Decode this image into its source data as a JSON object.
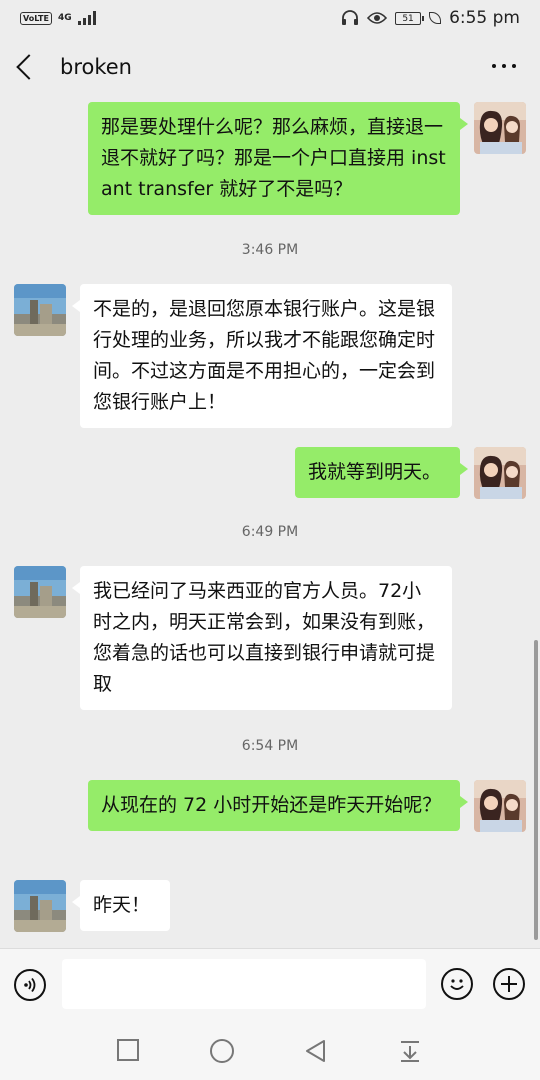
{
  "status": {
    "time": "6:55 pm",
    "battery": "51",
    "volte": "VoLTE",
    "network": "4G"
  },
  "header": {
    "title": "broken"
  },
  "messages": [
    {
      "side": "out",
      "text": "那是要处理什么呢？那么麻烦，直接退一退不就好了吗？那是一个户口直接用 instant transfer 就好了不是吗？"
    },
    {
      "time": "3:46 PM"
    },
    {
      "side": "in",
      "text": "不是的，是退回您原本银行账户。这是银行处理的业务，所以我才不能跟您确定时间。不过这方面是不用担心的，一定会到您银行账户上！"
    },
    {
      "side": "out",
      "text": "我就等到明天。"
    },
    {
      "time": "6:49 PM"
    },
    {
      "side": "in",
      "text": "我已经问了马来西亚的官方人员。72小时之内，明天正常会到，如果没有到账，您着急的话也可以直接到银行申请就可提取"
    },
    {
      "time": "6:54 PM"
    },
    {
      "side": "out",
      "text": "从现在的 72 小时开始还是昨天开始呢？"
    },
    {
      "side": "in",
      "text": "昨天！"
    }
  ],
  "input": {
    "value": ""
  },
  "icons": {
    "voice": "voice-icon",
    "emoji": "emoji-icon",
    "plus": "plus-icon",
    "back": "back-icon",
    "more": "more-icon",
    "nav_square": "recent-apps-icon",
    "nav_circle": "home-icon",
    "nav_triangle": "back-nav-icon",
    "nav_down": "notification-pull-icon"
  },
  "colors": {
    "outgoing_bubble": "#95ec69",
    "incoming_bubble": "#ffffff",
    "background": "#ededed"
  }
}
